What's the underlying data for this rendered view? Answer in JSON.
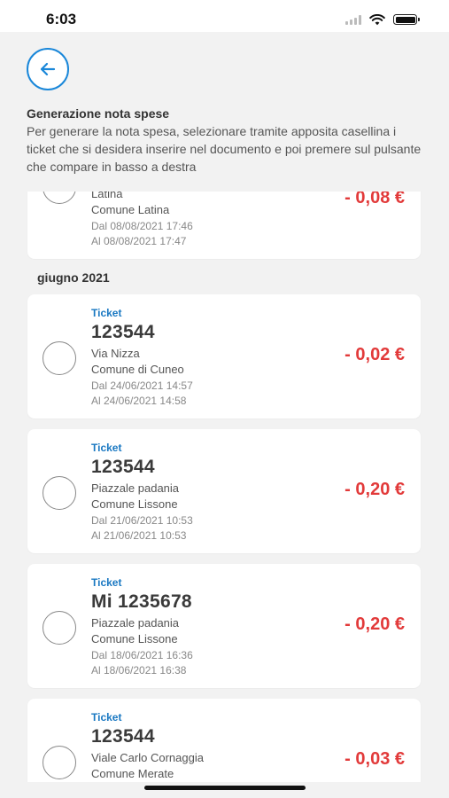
{
  "status_bar": {
    "time": "6:03"
  },
  "intro": {
    "title": "Generazione nota spese",
    "description": "Per generare la nota spesa, selezionare tramite apposita casellina i ticket che si desidera inserire nel documento e poi premere sul pulsante che compare in basso a destra"
  },
  "partial_item": {
    "address": "Latina",
    "city": "Comune Latina",
    "from": "Dal 08/08/2021 17:46",
    "to": "Al 08/08/2021 17:47",
    "amount": "- 0,08 €"
  },
  "month_header": "giugno 2021",
  "tickets": [
    {
      "type": "Ticket",
      "number": "123544",
      "address": "Via Nizza",
      "city": "Comune di Cuneo",
      "from": "Dal 24/06/2021 14:57",
      "to": "Al 24/06/2021 14:58",
      "amount": "- 0,02 €"
    },
    {
      "type": "Ticket",
      "number": "123544",
      "address": "Piazzale padania",
      "city": "Comune Lissone",
      "from": "Dal 21/06/2021 10:53",
      "to": "Al 21/06/2021 10:53",
      "amount": "- 0,20 €"
    },
    {
      "type": "Ticket",
      "number": "Mi 1235678",
      "address": "Piazzale padania",
      "city": "Comune Lissone",
      "from": "Dal 18/06/2021 16:36",
      "to": "Al 18/06/2021 16:38",
      "amount": "- 0,20 €"
    },
    {
      "type": "Ticket",
      "number": "123544",
      "address": "Viale Carlo Cornaggia",
      "city": "Comune Merate",
      "amount": "- 0,03 €"
    }
  ],
  "colors": {
    "accent": "#1a87d9",
    "amount": "#e23a3a",
    "background": "#f2f2f2"
  },
  "icons": {
    "back": "arrow-left-icon",
    "select": "radio-unchecked-icon"
  }
}
